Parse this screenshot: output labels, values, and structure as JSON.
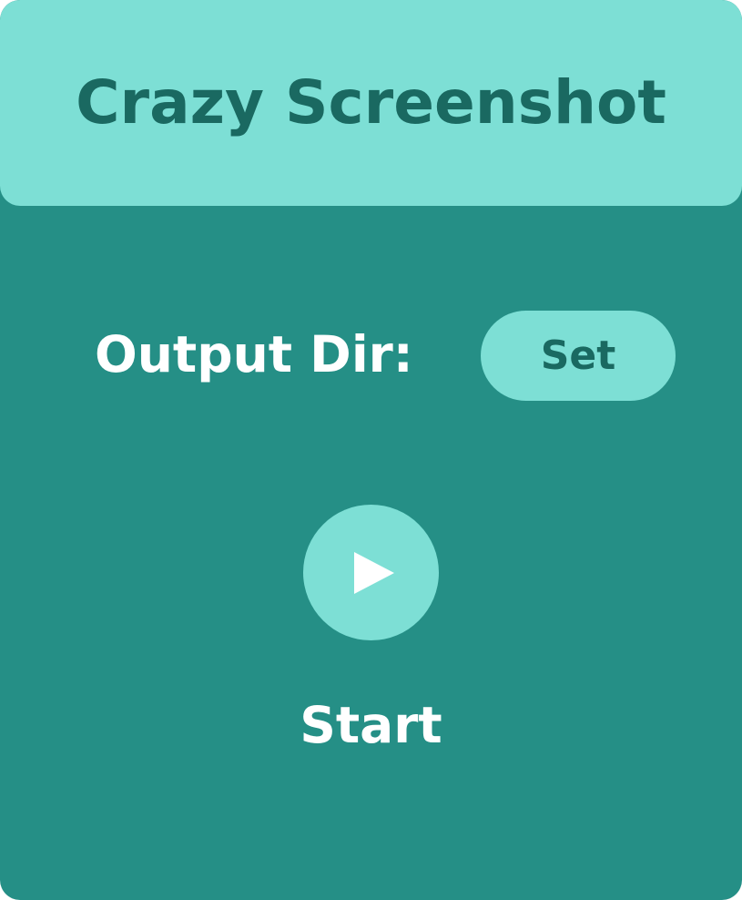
{
  "app": {
    "title": "Crazy Screenshot"
  },
  "output": {
    "label": "Output Dir:",
    "set_button_label": "Set"
  },
  "start": {
    "icon": "play-icon",
    "label": "Start"
  },
  "colors": {
    "background": "#258f86",
    "accent": "#7ddfd5",
    "dark_text": "#1a6961",
    "light_text": "#ffffff"
  }
}
